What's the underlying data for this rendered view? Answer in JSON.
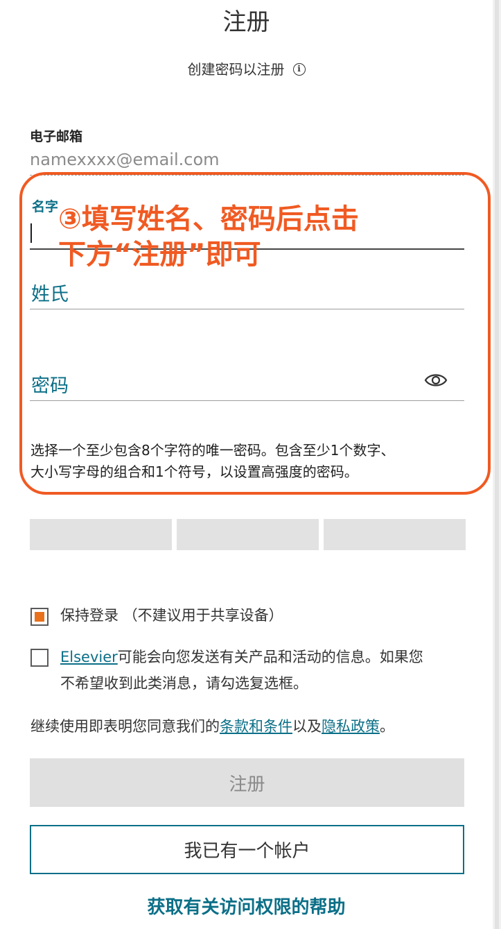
{
  "header": {
    "title": "注册",
    "subtitle": "创建密码以注册",
    "info_icon": "info-icon"
  },
  "form": {
    "email_label": "电子邮箱",
    "email_value": "namexxxx@email.com",
    "first_name_label": "名字",
    "last_name_label": "姓氏",
    "password_label": "密码",
    "password_toggle_icon": "eye-icon",
    "password_hint_line1": "选择一个至少包含8个字符的唯一密码。包含至少1个数字、",
    "password_hint_line2": "大小写字母的组合和1个符号，以设置高强度的密码。"
  },
  "annotation": {
    "line1": "③填写姓名、密码后点击",
    "line2": "下方“注册”即可",
    "color": "#f05a22"
  },
  "options": {
    "keep_signed_in": {
      "label": "保持登录 （不建议用于共享设备）",
      "checked": true
    },
    "marketing": {
      "link": "Elsevier",
      "text_line1": "可能会向您发送有关产品和活动的信息。如果您",
      "text_line2": "不希望收到此类消息，请勾选复选框。",
      "checked": false
    }
  },
  "terms": {
    "prefix": "继续使用即表明您同意我们的",
    "terms_link": "条款和条件",
    "middle": "以及",
    "privacy_link": "隐私政策",
    "suffix": "。"
  },
  "actions": {
    "register_label": "注册",
    "signin_label": "我已有一个帐户",
    "help_label": "获取有关访问权限的帮助"
  },
  "colors": {
    "accent": "#0b6f87",
    "checkbox_fill": "#e9711c",
    "disabled_button": "#e0e0e0"
  }
}
